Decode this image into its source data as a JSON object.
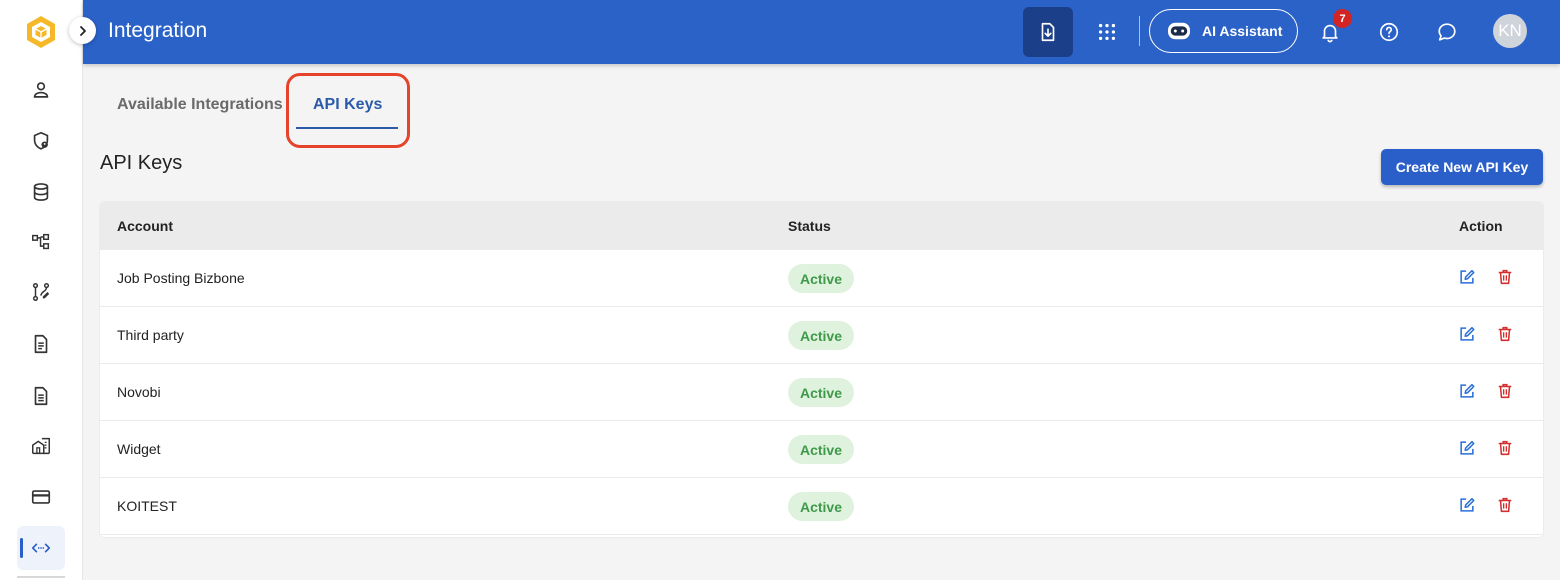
{
  "header": {
    "title": "Integration",
    "ai_assistant_label": "AI Assistant",
    "notification_count": "7",
    "avatar_initials": "KN"
  },
  "tabs": [
    {
      "label": "Available Integrations",
      "active": false
    },
    {
      "label": "API Keys",
      "active": true
    }
  ],
  "section": {
    "title": "API Keys",
    "create_button_label": "Create New API Key"
  },
  "table": {
    "columns": [
      "Account",
      "Status",
      "Action"
    ],
    "rows": [
      {
        "account": "Job Posting Bizbone",
        "status": "Active"
      },
      {
        "account": "Third party",
        "status": "Active"
      },
      {
        "account": "Novobi",
        "status": "Active"
      },
      {
        "account": "Widget",
        "status": "Active"
      },
      {
        "account": "KOITEST",
        "status": "Active"
      }
    ]
  },
  "sidebar": {
    "icons": [
      "user-icon",
      "shield-user-icon",
      "database-icon",
      "hierarchy-icon",
      "workflow-icon",
      "document-icon",
      "document-list-icon",
      "building-icon",
      "credit-card-icon",
      "integration-icon"
    ],
    "active": "integration-icon"
  },
  "colors": {
    "header_blue": "#2b62c8",
    "accent_blue": "#2a5fc9",
    "status_active_bg": "#dff2de",
    "status_active_text": "#3e9a4a",
    "delete_red": "#d32f2f",
    "highlight_red": "#e5432a"
  }
}
